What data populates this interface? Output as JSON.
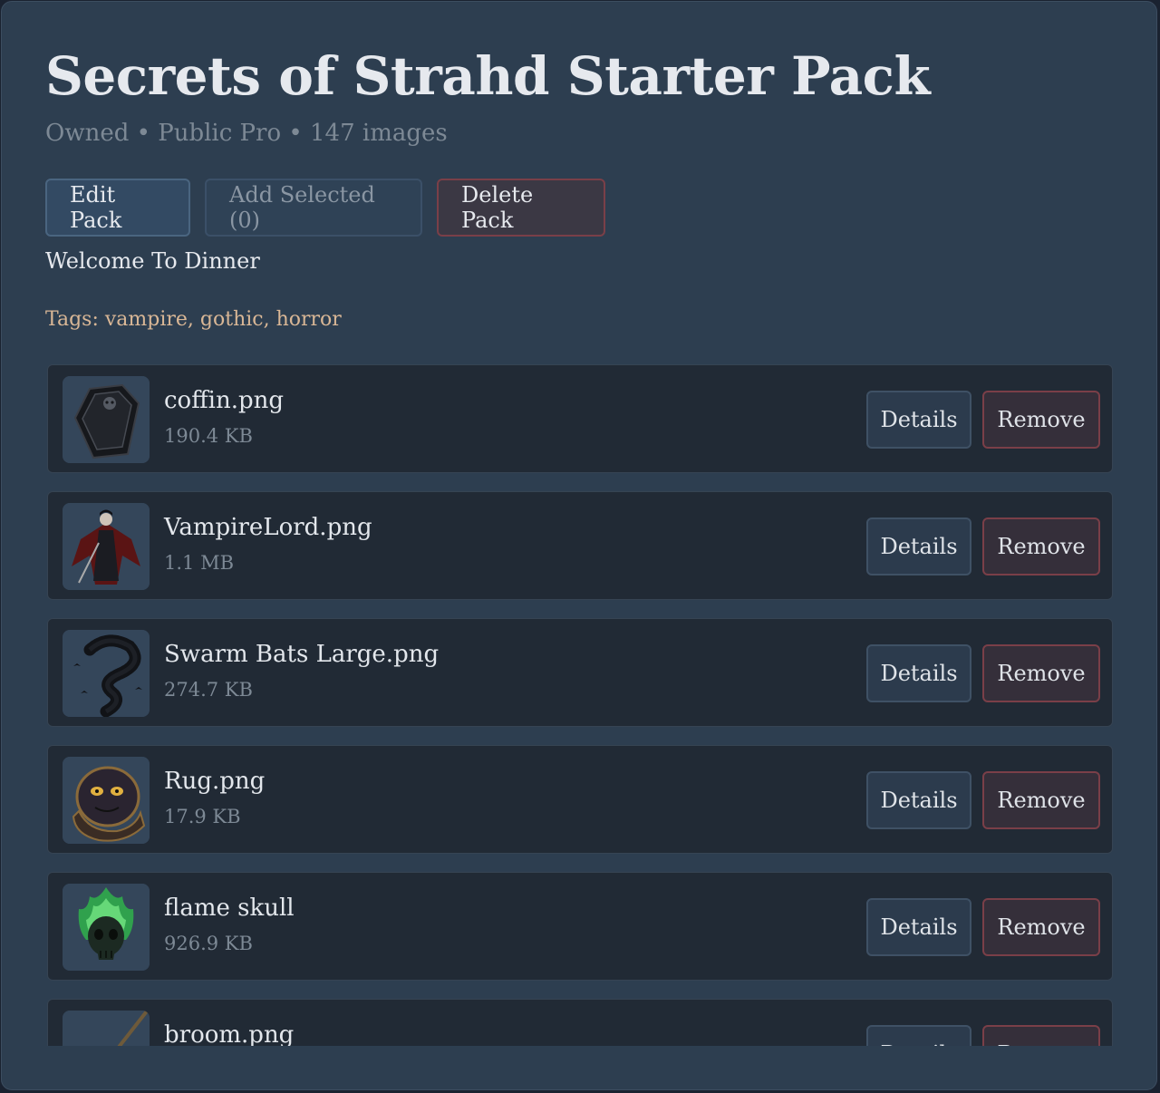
{
  "pack": {
    "title": "Secrets of Strahd Starter Pack",
    "meta": "Owned • Public Pro • 147 images",
    "description": "Welcome To Dinner",
    "tags_text": "Tags: vampire, gothic, horror"
  },
  "actions": {
    "edit_label": "Edit Pack",
    "add_selected_label": "Add Selected (0)",
    "delete_label": "Delete Pack"
  },
  "items": [
    {
      "name": "coffin.png",
      "size": "190.4 KB",
      "thumb_icon": "coffin-thumbnail",
      "details_label": "Details",
      "remove_label": "Remove"
    },
    {
      "name": "VampireLord.png",
      "size": "1.1 MB",
      "thumb_icon": "vampire-lord-thumbnail",
      "details_label": "Details",
      "remove_label": "Remove"
    },
    {
      "name": "Swarm Bats Large.png",
      "size": "274.7 KB",
      "thumb_icon": "bat-swarm-thumbnail",
      "details_label": "Details",
      "remove_label": "Remove"
    },
    {
      "name": "Rug.png",
      "size": "17.9 KB",
      "thumb_icon": "rug-thumbnail",
      "details_label": "Details",
      "remove_label": "Remove"
    },
    {
      "name": "flame skull",
      "size": "926.9 KB",
      "thumb_icon": "flame-skull-thumbnail",
      "details_label": "Details",
      "remove_label": "Remove"
    },
    {
      "name": "broom.png",
      "size": "",
      "thumb_icon": "broom-thumbnail",
      "details_label": "Details",
      "remove_label": "Remove"
    }
  ],
  "colors": {
    "background": "#2d3e50",
    "card": "#212a35",
    "tags_accent": "#d9b796",
    "danger_border": "#7a3f48"
  }
}
